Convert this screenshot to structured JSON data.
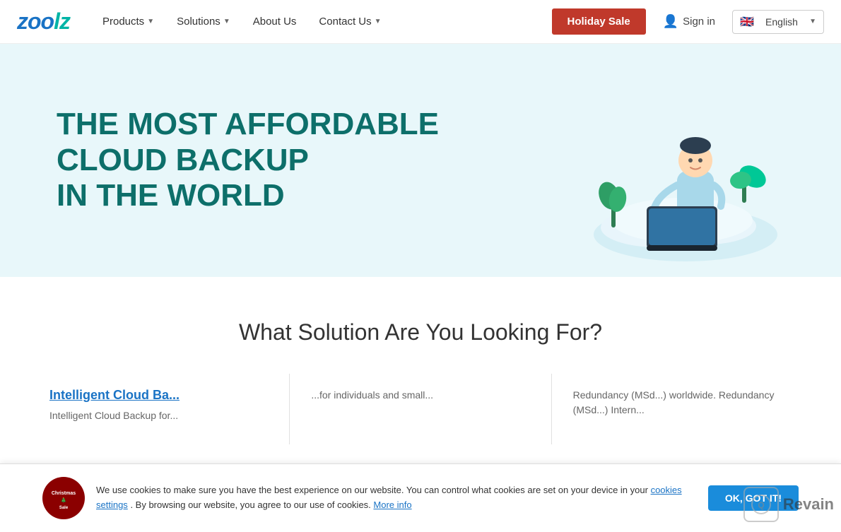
{
  "nav": {
    "logo_part1": "zoo",
    "logo_part2": "lz",
    "products_label": "Products",
    "solutions_label": "Solutions",
    "about_label": "About Us",
    "contact_label": "Contact Us",
    "holiday_sale_label": "Holiday Sale",
    "signin_label": "Sign in",
    "lang_flag": "🇬🇧",
    "lang_label": "English",
    "lang_chevron": "▼"
  },
  "hero": {
    "line1": "THE MOST AFFORDABLE",
    "line2": "CLOUD BACKUP",
    "line3": "IN THE WORLD"
  },
  "solutions": {
    "section_title": "What Solution Are You Looking For?",
    "columns": [
      {
        "title": "Intelligent Cloud Ba...",
        "description": "Intelligent Cloud Backup for..."
      },
      {
        "title": "",
        "description": "...for individuals and small..."
      },
      {
        "title": "",
        "description": "Redundancy (MSd...) worldwide. Redundancy (MSd...) Intern..."
      }
    ]
  },
  "cookie": {
    "text": "We use cookies to make sure you have the best experience on our website. You can control what cookies are set on your device in your",
    "cookies_settings_link": "cookies settings",
    "middle_text": ". By browsing our website, you agree to our use of cookies.",
    "more_info_link": "More info",
    "ok_label": "OK, GOT IT!"
  }
}
